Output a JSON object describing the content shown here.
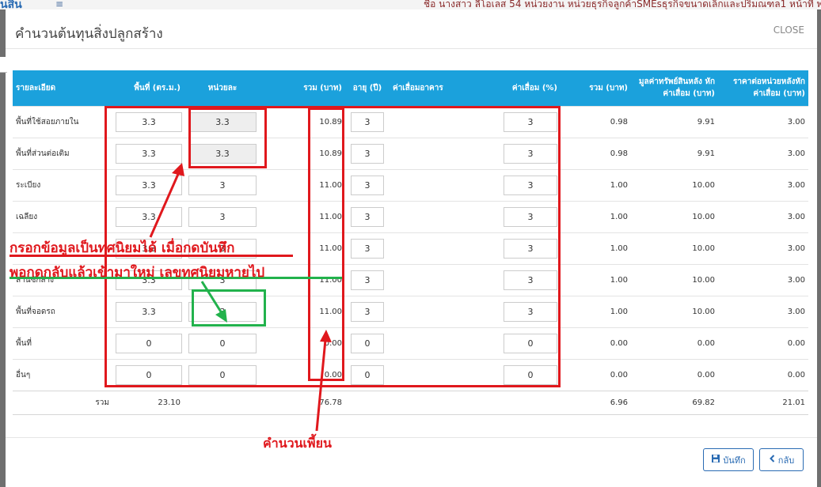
{
  "background": {
    "logo_text": "ุนสิน",
    "menu_glyph": "≡",
    "user_text": "ชื่อ นางสาว ลีโอเลส 54 หน่วยงาน หน่วยธุรกิจลูกค้าSMEsธุรกิจขนาดเล็กและปริมณฑล1 หน้าที่ พ"
  },
  "modal": {
    "title": "คำนวนต้นทุนสิ่งปลูกสร้าง",
    "close_label": "CLOSE"
  },
  "table": {
    "headers": {
      "detail": "รายละเอียด",
      "area": "พื้นที่ (ตร.ม.)",
      "unit_price": "หน่วยละ",
      "total": "รวม (บาท)",
      "age": "อายุ (ปี)",
      "dep_building": "ค่าเสื่อมอาคาร",
      "dep_percent": "ค่าเสื่อม (%)",
      "total2": "รวม (บาท)",
      "value_after": "มูลค่าทรัพย์สินหลัง หักค่าเสื่อม (บาท)",
      "price_per_unit_after": "ราคาต่อหน่วยหลังหัก ค่าเสื่อม (บาท)"
    },
    "rows": [
      {
        "detail": "พื้นที่ใช้สอยภายใน",
        "area": "3.3",
        "unit": "3.3",
        "total": "10.89",
        "age": "3",
        "dep": "3",
        "total2": "0.98",
        "value": "9.91",
        "ppu": "3.00"
      },
      {
        "detail": "พื้นที่ส่วนต่อเติม",
        "area": "3.3",
        "unit": "3.3",
        "total": "10.89",
        "age": "3",
        "dep": "3",
        "total2": "0.98",
        "value": "9.91",
        "ppu": "3.00"
      },
      {
        "detail": "ระเบียง",
        "area": "3.3",
        "unit": "3",
        "total": "11.00",
        "age": "3",
        "dep": "3",
        "total2": "1.00",
        "value": "10.00",
        "ppu": "3.00"
      },
      {
        "detail": "เฉลียง",
        "area": "3.3",
        "unit": "3",
        "total": "11.00",
        "age": "3",
        "dep": "3",
        "total2": "1.00",
        "value": "10.00",
        "ppu": "3.00"
      },
      {
        "detail": "",
        "area": "3.3",
        "unit": "3",
        "total": "11.00",
        "age": "3",
        "dep": "3",
        "total2": "1.00",
        "value": "10.00",
        "ppu": "3.00"
      },
      {
        "detail": "ลานซักล้าง",
        "area": "3.3",
        "unit": "3",
        "total": "11.00",
        "age": "3",
        "dep": "3",
        "total2": "1.00",
        "value": "10.00",
        "ppu": "3.00"
      },
      {
        "detail": "พื้นที่จอดรถ",
        "area": "3.3",
        "unit": "3",
        "total": "11.00",
        "age": "3",
        "dep": "3",
        "total2": "1.00",
        "value": "10.00",
        "ppu": "3.00"
      },
      {
        "detail": "พื้นที่",
        "area": "0",
        "unit": "0",
        "total": "0.00",
        "age": "0",
        "dep": "0",
        "total2": "0.00",
        "value": "0.00",
        "ppu": "0.00"
      },
      {
        "detail": "อื่นๆ",
        "area": "0",
        "unit": "0",
        "total": "0.00",
        "age": "0",
        "dep": "0",
        "total2": "0.00",
        "value": "0.00",
        "ppu": "0.00"
      }
    ],
    "sum": {
      "label": "รวม",
      "area": "23.10",
      "total": "76.78",
      "total2": "6.96",
      "value": "69.82",
      "ppu": "21.01"
    }
  },
  "buttons": {
    "save_label": "บันทึก",
    "save_icon": "floppy-icon",
    "back_label": "กลับ",
    "back_icon": "chevron-left-icon"
  },
  "annotations": {
    "note_decimal_line1": "กรอกข้อมูลเป็นทศนิยมได้ เมื่อกดบันทึก",
    "note_decimal_line2": "พอกดกลับแล้วเข้ามาใหม่ เลขทศนิยมหายไป",
    "note_calc": "คำนวนเพี้ยน",
    "red_color": "#e0181d",
    "green_color": "#22b24c"
  }
}
